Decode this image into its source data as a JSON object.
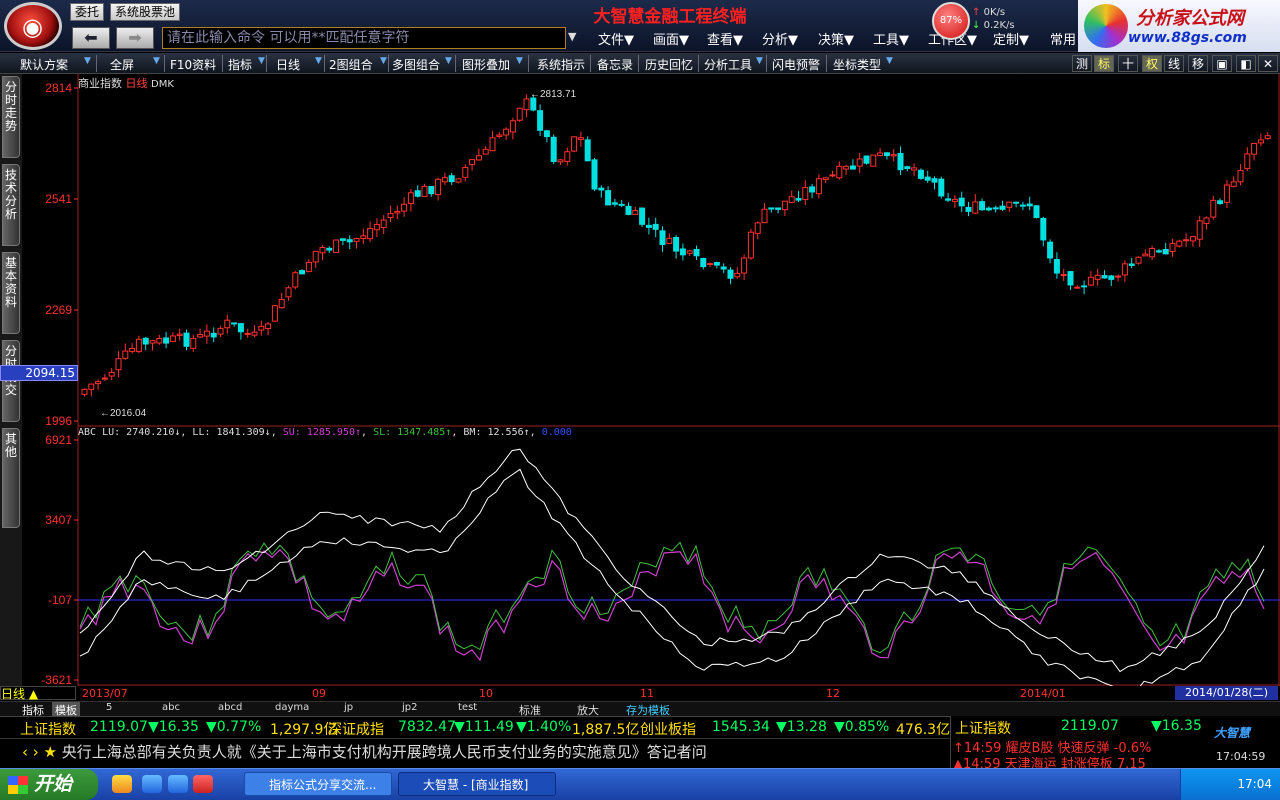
{
  "header": {
    "app_title": "大智慧金融工程终端",
    "buttons": {
      "entrust": "委托",
      "stock_pool": "系统股票池"
    },
    "command_placeholder": "请在此输入命令   可以用**匹配任意字符",
    "menus": [
      "文件▼",
      "画面▼",
      "查看▼",
      "分析▼",
      "决策▼",
      "工具▼",
      "工作区▼",
      "定制▼",
      "常用"
    ],
    "gauge_percent": "87%",
    "speed_up": "0K/s",
    "speed_down": "0.2K/s",
    "promo_title": "分析家公式网",
    "promo_url": "www.88gs.com"
  },
  "toolbar": {
    "items": [
      "默认方案",
      "全屏",
      "F10资料",
      "指标",
      "日线",
      "2图组合",
      "多图组合",
      "图形叠加",
      "系统指示",
      "备忘录",
      "历史回忆",
      "分析工具",
      "闪电预警",
      "坐标类型"
    ],
    "right_items": [
      "测",
      "标",
      "十",
      "权",
      "线",
      "移"
    ]
  },
  "left_tabs": [
    "分时走势",
    "技术分析",
    "基本资料",
    "分时成交",
    "其他"
  ],
  "chart": {
    "name": "商业指数",
    "period": "日线",
    "indicator": "DMK",
    "current_price_label": "2094.15",
    "high_label": "2813.71",
    "low_label": "2016.04",
    "price_ticks": [
      "2814",
      "2541",
      "2269",
      "1996"
    ],
    "indicator_ticks": [
      "6921",
      "3407",
      "-107",
      "-3621"
    ],
    "info": {
      "prefix": "ABC",
      "lu": "LU: 2740.210↓",
      "ll": "LL: 1841.309↓",
      "su": "SU: 1285.950↑",
      "sl": "SL: 1347.485↑",
      "bm": "BM: 12.556↑",
      "extra": "0.000"
    },
    "date_labels": [
      "2013/07",
      "09",
      "10",
      "11",
      "12",
      "2014/01"
    ],
    "current_date": "2014/01/28(二)",
    "period_label": "日线"
  },
  "bottom_tabs": [
    "指标",
    "模板",
    "5",
    "abc",
    "abcd",
    "dayma",
    "jp",
    "jp2",
    "test",
    "标准",
    "放大",
    "存为模板"
  ],
  "ticker": [
    {
      "name": "上证指数",
      "price": "2119.07",
      "change": "▼16.35",
      "pct": "▼0.77%",
      "amount": "1,297.9亿"
    },
    {
      "name": "深证成指",
      "price": "7832.47",
      "change": "▼111.49",
      "pct": "▼1.40%",
      "amount": "1,887.5亿"
    },
    {
      "name": "创业板指",
      "price": "1545.34",
      "change": "▼13.28",
      "pct": "▼0.85%",
      "amount": "476.3亿"
    }
  ],
  "news": "央行上海总部有关负责人就《关于上海市支付机构开展跨境人民币支付业务的实施意见》答记者问",
  "right_panel": {
    "name": "上证指数",
    "price": "2119.07",
    "change": "▼16.35",
    "alert1": "↑14:59 耀皮B股 快速反弹 -0.6%",
    "alert2": "▲14:59 天津海运 封涨停板 7.15",
    "brand": "大智慧",
    "clock": "17:04:59"
  },
  "taskbar": {
    "start": "开始",
    "task1": "指标公式分享交流...",
    "task2": "大智慧 - [商业指数]",
    "time": "17:04"
  },
  "colors": {
    "up": "#ff3030",
    "down": "#00e0e0",
    "cmd_border": "#b08020",
    "purple_line": "#d040d0",
    "green_line": "#40c040",
    "blue_line": "#3030ff"
  }
}
